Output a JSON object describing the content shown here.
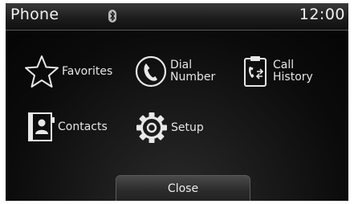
{
  "header": {
    "title": "Phone",
    "status_icon": "bluetooth-icon",
    "time": "12:00"
  },
  "menu": {
    "favorites": {
      "label": "Favorites",
      "icon": "star-icon"
    },
    "dial_number": {
      "line1": "Dial",
      "line2": "Number",
      "icon": "phone-handset-icon"
    },
    "call_history": {
      "line1": "Call",
      "line2": "History",
      "icon": "call-history-icon"
    },
    "contacts": {
      "label": "Contacts",
      "icon": "contacts-book-icon"
    },
    "setup": {
      "label": "Setup",
      "icon": "gear-icon"
    }
  },
  "footer": {
    "close_label": "Close"
  },
  "colors": {
    "background": "#050505",
    "text": "#e6e6e6",
    "bar": "#2b2b2b"
  }
}
